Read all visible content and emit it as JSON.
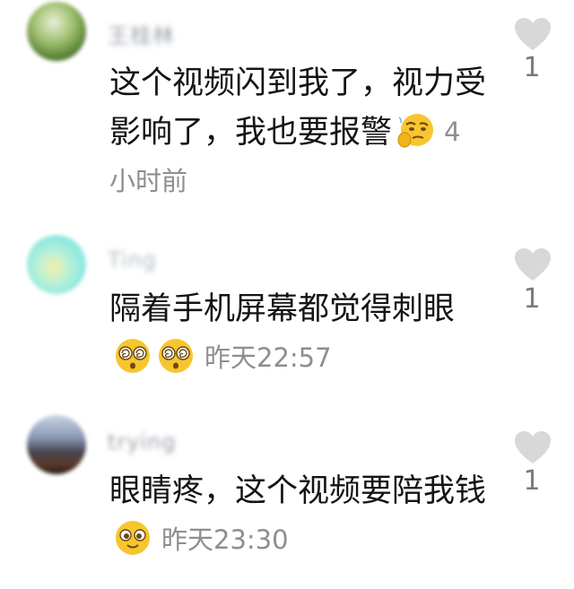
{
  "comments": [
    {
      "username": "王桂林",
      "text": "这个视频闪到我了，视力受影响了，我也要报警",
      "emoji": [
        "thinking-emoji"
      ],
      "time": "4小时前",
      "likes": "1"
    },
    {
      "username": "Ting",
      "text": "隔着手机屏幕都觉得刺眼",
      "emoji": [
        "dizzy-eyes-emoji",
        "dizzy-eyes-emoji"
      ],
      "time": "昨天22:57",
      "likes": "1"
    },
    {
      "username": "trying",
      "text": "眼睛疼，这个视频要陪我钱",
      "emoji": [
        "smiling-emoji"
      ],
      "time": "昨天23:30",
      "likes": "1"
    }
  ],
  "colors": {
    "text": "#141414",
    "meta": "#8e8e8e",
    "heart": "#d8d8d8"
  }
}
